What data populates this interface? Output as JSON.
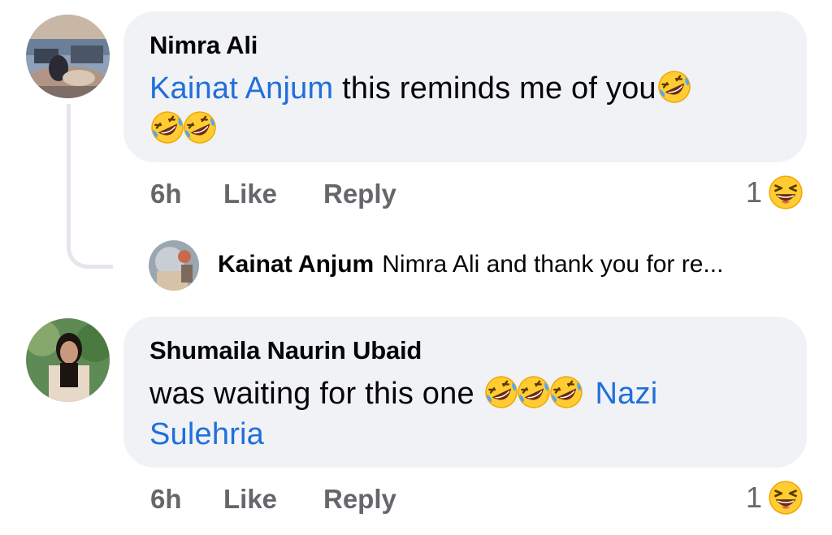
{
  "comments": [
    {
      "author": "Nimra Ali",
      "mention": "Kainat Anjum",
      "text": " this reminds me of you",
      "time": "6h",
      "like_label": "Like",
      "reply_label": "Reply",
      "reaction_count": "1",
      "reaction_icon": "laughing-squint-emoji-icon",
      "inline_emoji_icon": "rolling-laughing-emoji-icon"
    },
    {
      "author": "Shumaila Naurin Ubaid",
      "text": "was waiting for this one ",
      "mention": "Nazi Sulehria",
      "mention_line1": "Nazi",
      "mention_line2": "Sulehria",
      "time": "6h",
      "like_label": "Like",
      "reply_label": "Reply",
      "reaction_count": "1",
      "reaction_icon": "laughing-squint-emoji-icon",
      "inline_emoji_icon": "rolling-laughing-emoji-icon"
    }
  ],
  "reply_preview": {
    "author": "Kainat Anjum",
    "text": "Nimra Ali and thank you for re..."
  },
  "colors": {
    "bubble": "#f0f2f5",
    "mention": "#216fdb",
    "meta": "#65676b",
    "emoji": "#ffc93a"
  }
}
